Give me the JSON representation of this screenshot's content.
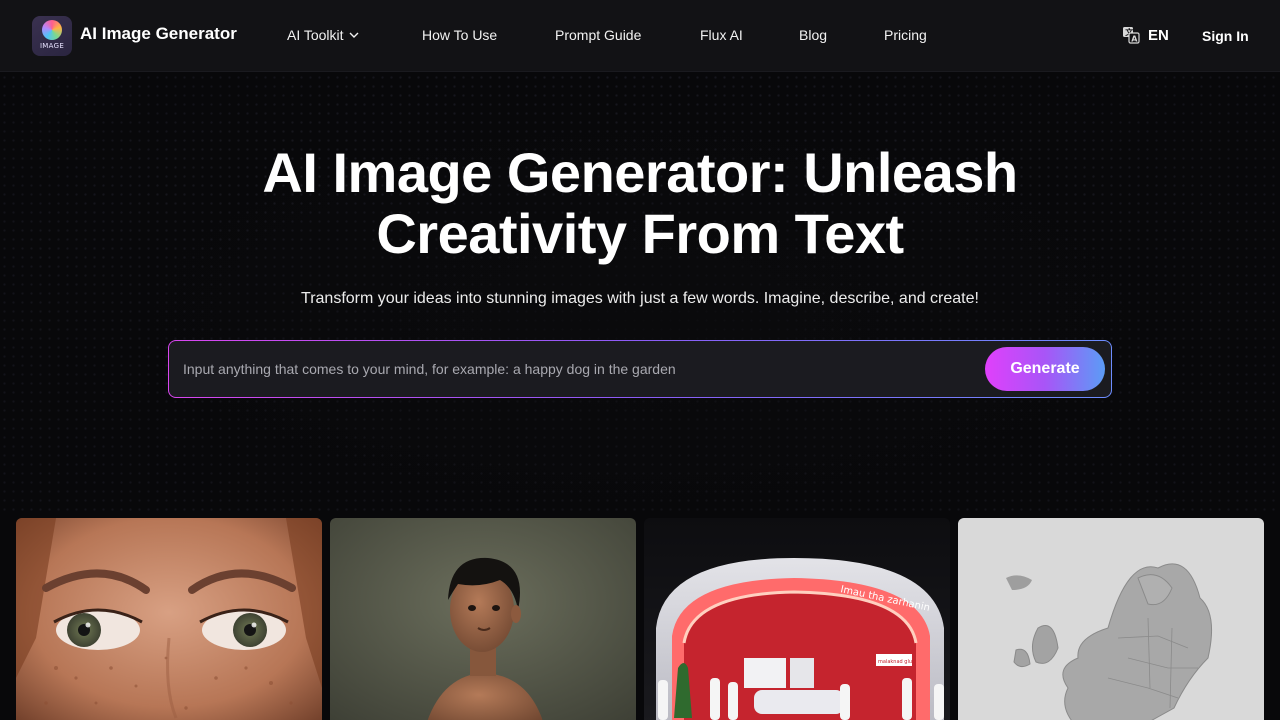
{
  "nav": {
    "logo_text": "IMAGE",
    "brand": "AI Image Generator",
    "items": [
      {
        "label": "AI Toolkit",
        "has_dropdown": true
      },
      {
        "label": "How To Use"
      },
      {
        "label": "Prompt Guide"
      },
      {
        "label": "Flux AI"
      },
      {
        "label": "Blog"
      },
      {
        "label": "Pricing"
      }
    ],
    "language": "EN",
    "sign_in": "Sign In"
  },
  "hero": {
    "title_line1": "AI Image Generator: Unleash",
    "title_line2": "Creativity From Text",
    "subtitle": "Transform your ideas into stunning images with just a few words. Imagine, describe, and create!",
    "prompt_placeholder": "Input anything that comes to your mind, for example: a happy dog in the garden",
    "generate_label": "Generate"
  },
  "gallery": {
    "images": [
      {
        "name": "freckled-eyes-portrait"
      },
      {
        "name": "boy-portrait"
      },
      {
        "name": "red-booth-render",
        "sign_text": "Imau tha zarhanin",
        "panel_text": "malaknad glue"
      },
      {
        "name": "europe-relief-map"
      }
    ]
  },
  "colors": {
    "background": "#08080a",
    "nav_bg": "#121215",
    "accent_start": "#e040fb",
    "accent_end": "#5b9cf6"
  }
}
